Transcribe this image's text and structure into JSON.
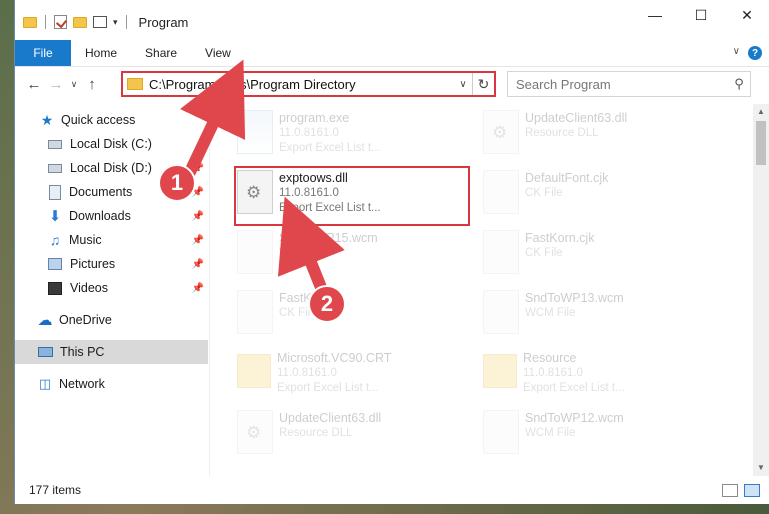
{
  "window": {
    "title": "Program"
  },
  "ribbon": {
    "tabs": [
      {
        "label": "File",
        "active": true
      },
      {
        "label": "Home"
      },
      {
        "label": "Share"
      },
      {
        "label": "View"
      }
    ],
    "help_icon": "?"
  },
  "navbar": {
    "address": "C:\\Program Files\\Program Directory",
    "search_placeholder": "Search Program"
  },
  "sidebar": {
    "items": [
      {
        "label": "Quick access",
        "icon": "star-icon"
      },
      {
        "label": "Local Disk (C:)",
        "icon": "disk-icon"
      },
      {
        "label": "Local Disk (D:)",
        "icon": "disk-icon",
        "pinned": true
      },
      {
        "label": "Documents",
        "icon": "documents-icon",
        "pinned": true
      },
      {
        "label": "Downloads",
        "icon": "download-icon",
        "pinned": true
      },
      {
        "label": "Music",
        "icon": "music-icon",
        "pinned": true
      },
      {
        "label": "Pictures",
        "icon": "pictures-icon",
        "pinned": true
      },
      {
        "label": "Videos",
        "icon": "videos-icon",
        "pinned": true
      },
      {
        "label": "OneDrive",
        "icon": "cloud-icon"
      },
      {
        "label": "This PC",
        "icon": "pc-icon",
        "selected": true
      },
      {
        "label": "Network",
        "icon": "network-icon"
      }
    ]
  },
  "files": {
    "left": [
      {
        "name": "program.exe",
        "meta1": "11.0.8161.0",
        "meta2": "Export Excel List t...",
        "kind": "exe",
        "faded": true
      },
      {
        "name": "exptoows.dll",
        "meta1": "11.0.8161.0",
        "meta2": "Export Excel List t...",
        "kind": "gear",
        "faded": false
      },
      {
        "name": "SndToWP15.wcm",
        "meta1": "WCM File",
        "meta2": "",
        "kind": "blank",
        "faded": true
      },
      {
        "name": "FastKor.cjk",
        "meta1": "CK File",
        "meta2": "",
        "kind": "blank",
        "faded": true
      },
      {
        "name": "Microsoft.VC90.CRT",
        "meta1": "11.0.8161.0",
        "meta2": "Export Excel List t...",
        "kind": "folder",
        "faded": true
      },
      {
        "name": "UpdateClient63.dll",
        "meta1": "Resource DLL",
        "meta2": "",
        "kind": "gear",
        "faded": true
      }
    ],
    "right": [
      {
        "name": "UpdateClient63.dll",
        "meta1": "Resource DLL",
        "meta2": "",
        "kind": "gear",
        "faded": true
      },
      {
        "name": "DefaultFont.cjk",
        "meta1": "CK File",
        "meta2": "",
        "kind": "blank",
        "faded": true
      },
      {
        "name": "FastKorn.cjk",
        "meta1": "CK File",
        "meta2": "",
        "kind": "blank",
        "faded": true
      },
      {
        "name": "SndToWP13.wcm",
        "meta1": "WCM File",
        "meta2": "",
        "kind": "blank",
        "faded": true
      },
      {
        "name": "Resource",
        "meta1": "11.0.8161.0",
        "meta2": "Export Excel List t...",
        "kind": "folder",
        "faded": true
      },
      {
        "name": "SndToWP12.wcm",
        "meta1": "WCM File",
        "meta2": "",
        "kind": "blank",
        "faded": true
      }
    ]
  },
  "status": {
    "items_count": "177 items"
  },
  "annotations": {
    "step1": "1",
    "step2": "2",
    "accent": "#e0474c"
  }
}
